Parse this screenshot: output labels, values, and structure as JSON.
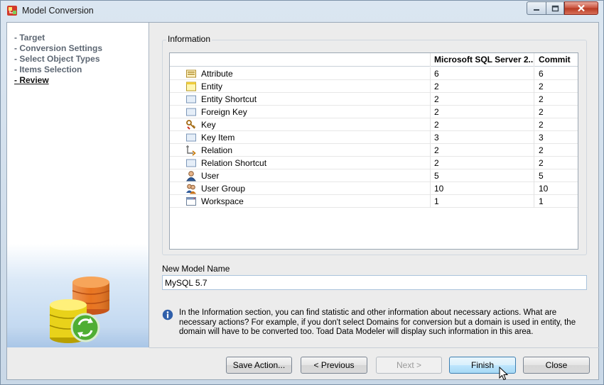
{
  "window": {
    "title": "Model Conversion"
  },
  "steps": [
    "- Target",
    "- Conversion Settings",
    "- Select Object Types",
    "- Items Selection",
    "- Review"
  ],
  "info": {
    "legend": "Information",
    "headers": {
      "name": "",
      "ms": "Microsoft SQL Server 2...",
      "commit": "Commit"
    },
    "rows": [
      {
        "icon": "attribute-icon",
        "name": "Attribute",
        "ms": "6",
        "commit": "6"
      },
      {
        "icon": "entity-icon",
        "name": "Entity",
        "ms": "2",
        "commit": "2"
      },
      {
        "icon": "entity-shortcut-icon",
        "name": "Entity Shortcut",
        "ms": "2",
        "commit": "2"
      },
      {
        "icon": "foreign-key-icon",
        "name": "Foreign Key",
        "ms": "2",
        "commit": "2"
      },
      {
        "icon": "key-icon",
        "name": "Key",
        "ms": "2",
        "commit": "2"
      },
      {
        "icon": "key-item-icon",
        "name": "Key Item",
        "ms": "3",
        "commit": "3"
      },
      {
        "icon": "relation-icon",
        "name": "Relation",
        "ms": "2",
        "commit": "2"
      },
      {
        "icon": "relation-shortcut-icon",
        "name": "Relation Shortcut",
        "ms": "2",
        "commit": "2"
      },
      {
        "icon": "user-icon",
        "name": "User",
        "ms": "5",
        "commit": "5"
      },
      {
        "icon": "user-group-icon",
        "name": "User Group",
        "ms": "10",
        "commit": "10"
      },
      {
        "icon": "workspace-icon",
        "name": "Workspace",
        "ms": "1",
        "commit": "1"
      }
    ]
  },
  "model_name": {
    "label": "New Model Name",
    "value": "MySQL 5.7"
  },
  "note": "In the Information section, you can find statistic and other information about necessary actions. What are necessary actions? For example, if you don't select Domains for conversion but a domain is used in entity, the domain will have to be converted too. Toad Data Modeler will display such information in this area.",
  "buttons": {
    "save": "Save Action...",
    "previous": "< Previous",
    "next": "Next >",
    "finish": "Finish",
    "close": "Close"
  },
  "colors": {
    "accent": "#3c7fb1",
    "info_icon": "#2f5faa"
  }
}
